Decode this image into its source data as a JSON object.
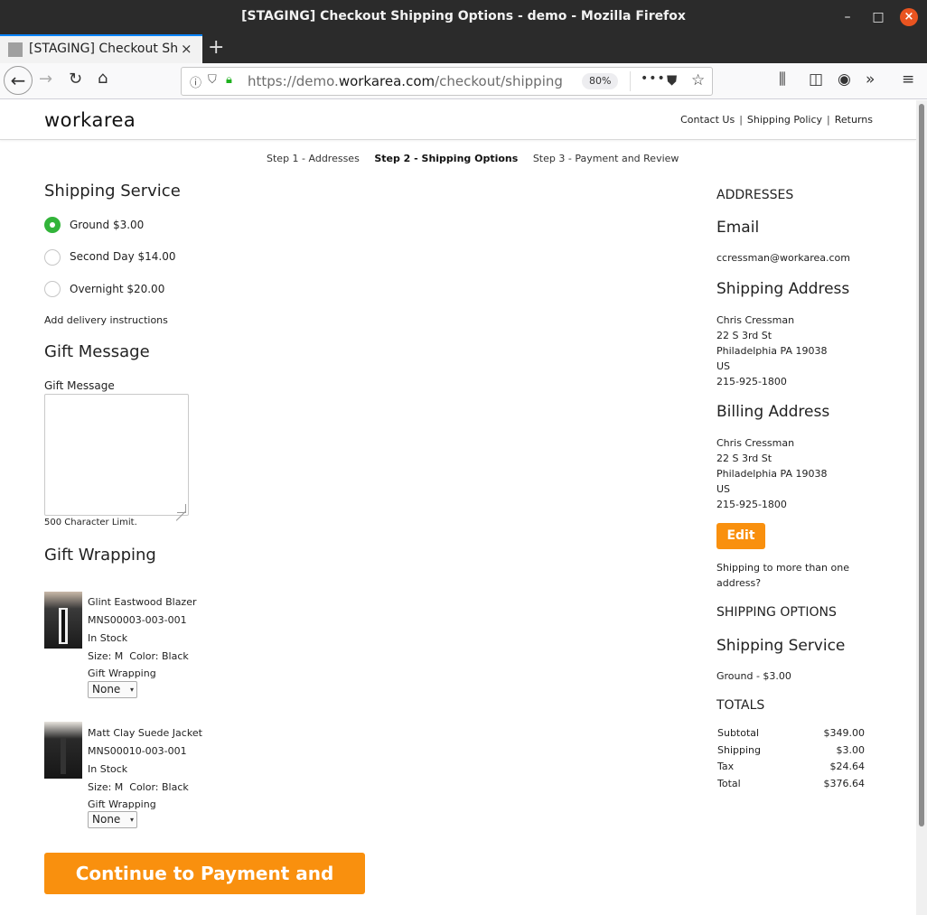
{
  "window": {
    "title": "[STAGING] Checkout Shipping Options - demo - Mozilla Firefox",
    "tab_title": "[STAGING] Checkout Shipping Options - demo",
    "url_prefix": "https://demo.",
    "url_domain": "workarea.com",
    "url_path": "/checkout/shipping",
    "zoom": "80%"
  },
  "site": {
    "logo": "workarea",
    "links": [
      "Contact Us",
      "Shipping Policy",
      "Returns"
    ]
  },
  "steps": [
    "Step 1 - Addresses",
    "Step 2 - Shipping Options",
    "Step 3 - Payment and Review"
  ],
  "shipping_service": {
    "heading": "Shipping Service",
    "options": [
      {
        "label": "Ground $3.00",
        "selected": true
      },
      {
        "label": "Second Day $14.00",
        "selected": false
      },
      {
        "label": "Overnight $20.00",
        "selected": false
      }
    ],
    "delivery_link": "Add delivery instructions"
  },
  "gift_message": {
    "heading": "Gift Message",
    "label": "Gift Message",
    "limit": "500 Character Limit."
  },
  "gift_wrapping": {
    "heading": "Gift Wrapping",
    "items": [
      {
        "name": "Glint Eastwood Blazer",
        "sku": "MNS00003-003-001",
        "stock": "In Stock",
        "attrs": "Size: M  Color: Black",
        "wrap_label": "Gift Wrapping",
        "wrap_value": "None"
      },
      {
        "name": "Matt Clay Suede Jacket",
        "sku": "MNS00010-003-001",
        "stock": "In Stock",
        "attrs": "Size: M  Color: Black",
        "wrap_label": "Gift Wrapping",
        "wrap_value": "None"
      }
    ]
  },
  "cta": "Continue to Payment and Review",
  "summary": {
    "addresses_heading": "ADDRESSES",
    "email_heading": "Email",
    "email": "ccressman@workarea.com",
    "shipping_heading": "Shipping Address",
    "shipping_address": [
      "Chris Cressman",
      "22 S 3rd St",
      "Philadelphia PA 19038",
      "US",
      "215-925-1800"
    ],
    "billing_heading": "Billing Address",
    "billing_address": [
      "Chris Cressman",
      "22 S 3rd St",
      "Philadelphia PA 19038",
      "US",
      "215-925-1800"
    ],
    "edit": "Edit",
    "multi_ship": "Shipping to more than one address?",
    "options_heading": "SHIPPING OPTIONS",
    "service_heading": "Shipping Service",
    "service_value": "Ground - $3.00",
    "totals_heading": "TOTALS",
    "totals": [
      {
        "label": "Subtotal",
        "value": "$349.00"
      },
      {
        "label": "Shipping",
        "value": "$3.00"
      },
      {
        "label": "Tax",
        "value": "$24.64"
      },
      {
        "label": "Total",
        "value": "$376.64"
      }
    ]
  },
  "colors": {
    "accent": "#f9900e",
    "radio_selected": "#32b43a",
    "lock": "#1fb11f",
    "close_button": "#e95420"
  }
}
